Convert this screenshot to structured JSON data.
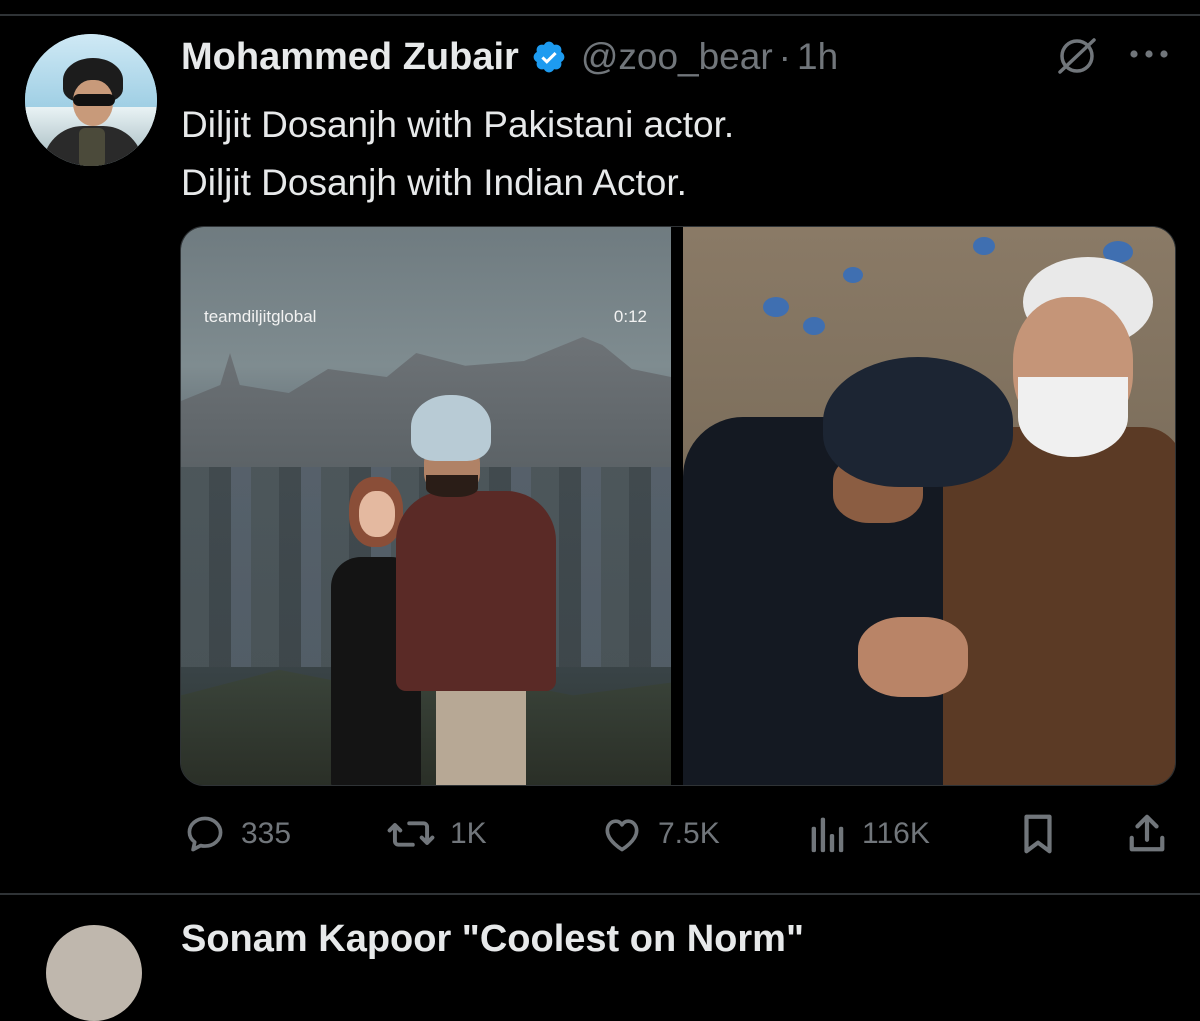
{
  "tweet": {
    "author": {
      "display_name": "Mohammed Zubair",
      "handle": "@zoo_bear",
      "verified": true,
      "avatar_icon": "profile-avatar"
    },
    "separator": "·",
    "timestamp": "1h",
    "text_lines": [
      "Diljit Dosanjh with Pakistani actor.",
      "Diljit Dosanjh with Indian Actor."
    ],
    "media": {
      "left": {
        "video_watermark": "teamdiljitglobal",
        "video_duration": "0:12"
      }
    },
    "actions": {
      "replies": "335",
      "reposts": "1K",
      "likes": "7.5K",
      "views": "116K"
    }
  },
  "next_tweet": {
    "display_name_partial": "Sonam Kapoor \"Coolest on Norm\""
  },
  "colors": {
    "background": "#000000",
    "text": "#e7e9ea",
    "muted": "#71767b",
    "verified_blue": "#1d9bf0",
    "divider": "#2f3336"
  }
}
